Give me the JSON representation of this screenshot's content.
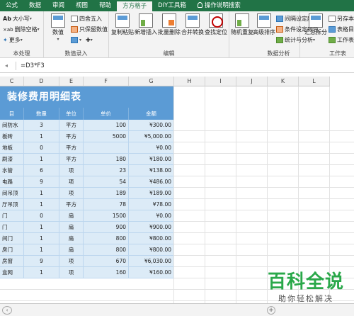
{
  "ribbon_tabs": [
    "公式",
    "数据",
    "审阅",
    "视图",
    "帮助",
    "方方格子",
    "DIY工具箱",
    "操作说明搜索"
  ],
  "active_tab": "方方格子",
  "ribbon": {
    "text_group": {
      "items": [
        "大小写",
        "删除空格",
        "更多"
      ],
      "label": "本处理",
      "ab": "Ab",
      "xab": "×ab"
    },
    "numeric_group": {
      "big": "数值",
      "items": [
        "四舍五入",
        "只保留数值"
      ],
      "label": "数值录入"
    },
    "edit_group": {
      "buttons": [
        "复制粘贴",
        "新增插入",
        "批量删除",
        "合并转换",
        "查找定位"
      ],
      "label": "编辑"
    },
    "analysis_group": {
      "buttons": [
        "随机重复",
        "高级排序"
      ],
      "items": [
        "间隔设定颜色",
        "条件设定颜色",
        "统计与分析"
      ],
      "label": "数据分析"
    },
    "tools_group": {
      "big": "汇总拆分",
      "items": [
        "另存本表",
        "表格目录",
        "工作表"
      ],
      "label": "工作表"
    }
  },
  "formula_bar": {
    "formula": "=D3*F3"
  },
  "columns": [
    "C",
    "D",
    "E",
    "F",
    "G",
    "H",
    "I",
    "J",
    "K",
    "L"
  ],
  "sheet": {
    "title": "装修费用明细表",
    "headers": [
      "目",
      "数量",
      "单位",
      "单价",
      "金额"
    ],
    "rows": [
      [
        "间防水",
        "3",
        "平方",
        "100",
        "¥300.00"
      ],
      [
        "板砖",
        "1",
        "平方",
        "5000",
        "¥5,000.00"
      ],
      [
        "地板",
        "0",
        "平方",
        "",
        "¥0.00"
      ],
      [
        "刷漆",
        "1",
        "平方",
        "180",
        "¥180.00"
      ],
      [
        "水管",
        "6",
        "项",
        "23",
        "¥138.00"
      ],
      [
        "电路",
        "9",
        "项",
        "54",
        "¥486.00"
      ],
      [
        "间吊顶",
        "1",
        "项",
        "189",
        "¥189.00"
      ],
      [
        "厅吊顶",
        "1",
        "平方",
        "78",
        "¥78.00"
      ],
      [
        "门",
        "0",
        "扇",
        "1500",
        "¥0.00"
      ],
      [
        "门",
        "1",
        "扇",
        "900",
        "¥900.00"
      ],
      [
        "间门",
        "1",
        "扇",
        "800",
        "¥800.00"
      ],
      [
        "房门",
        "1",
        "扇",
        "800",
        "¥800.00"
      ],
      [
        "房窗",
        "9",
        "项",
        "670",
        "¥6,030.00"
      ],
      [
        "盒网",
        "1",
        "项",
        "160",
        "¥160.00"
      ]
    ]
  },
  "watermark": {
    "main": "百科全说",
    "sub": "助你轻松解决"
  },
  "colors": {
    "excel_green": "#217346",
    "header_blue": "#5b9bd5",
    "row_tint": "#dcebf7",
    "watermark_green": "#2aa84a"
  }
}
